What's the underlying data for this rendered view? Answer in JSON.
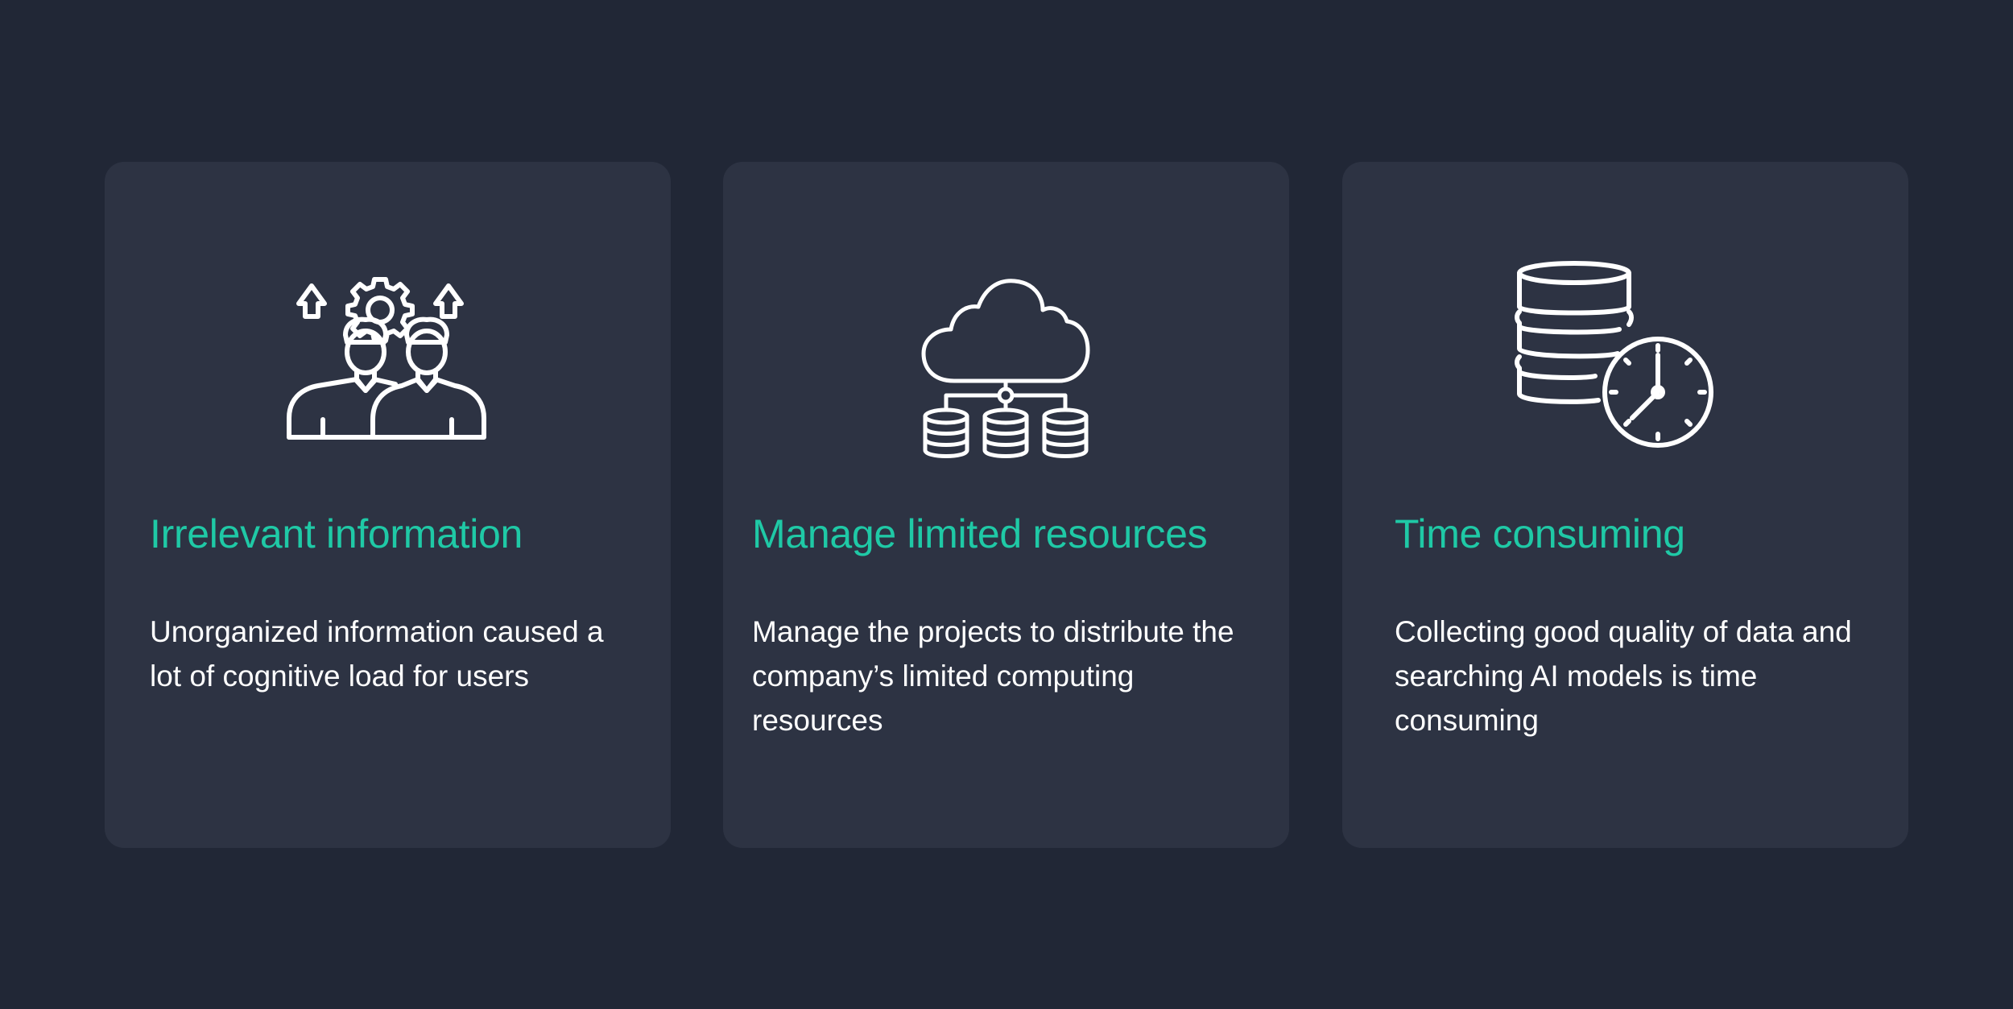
{
  "colors": {
    "background": "#212736",
    "card": "#2d3343",
    "accent": "#1fc9a6",
    "text": "#ffffff"
  },
  "cards": [
    {
      "icon": "team-settings-icon",
      "title": "Irrelevant information",
      "description": "Unorganized information caused a lot of cognitive load for users"
    },
    {
      "icon": "cloud-database-icon",
      "title": "Manage limited resources",
      "description": "Manage the projects to distribute the company’s limited computing resources"
    },
    {
      "icon": "database-clock-icon",
      "title": "Time consuming",
      "description": "Collecting good quality of data and searching AI models is time consuming"
    }
  ]
}
